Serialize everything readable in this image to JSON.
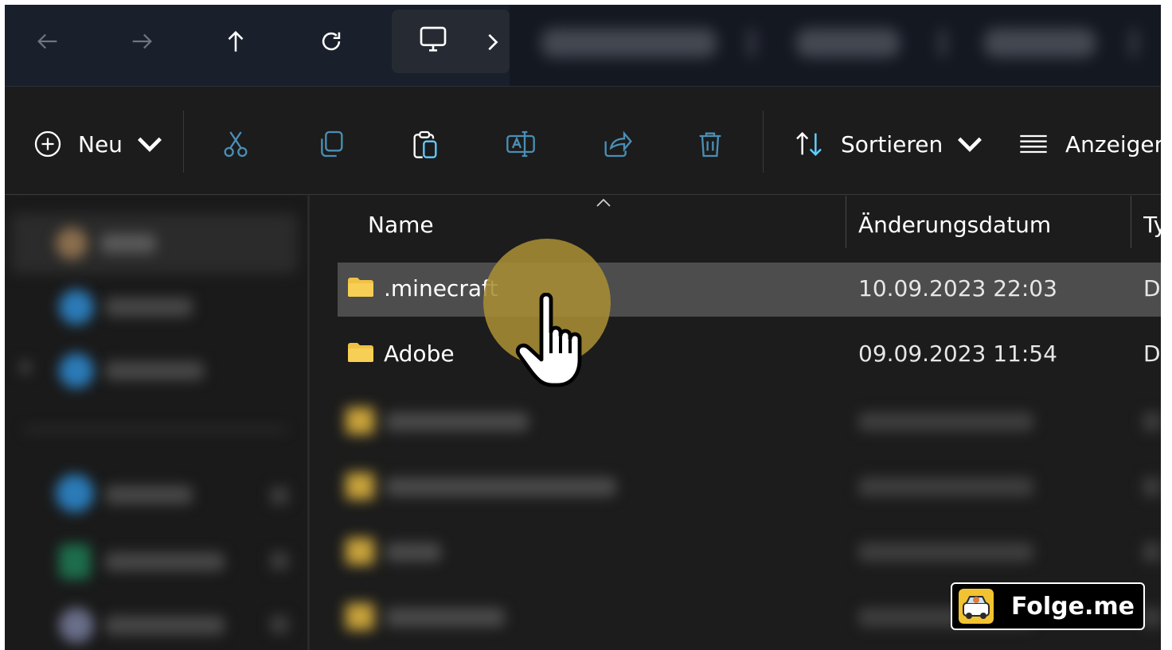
{
  "nav": {
    "buttons": [
      "back",
      "forward",
      "up",
      "refresh"
    ],
    "location_icon": "this-pc-icon"
  },
  "commandbar": {
    "new_label": "Neu",
    "sort_label": "Sortieren",
    "view_label": "Anzeigen",
    "icons": [
      "cut-icon",
      "copy-icon",
      "paste-icon",
      "rename-icon",
      "share-icon",
      "delete-icon"
    ]
  },
  "columns": {
    "name": "Name",
    "modified": "Änderungsdatum",
    "type": "Typ"
  },
  "files": [
    {
      "name": ".minecraft",
      "modified": "10.09.2023 22:03",
      "type": "D",
      "selected": true
    },
    {
      "name": "Adobe",
      "modified": "09.09.2023 11:54",
      "type": "D",
      "selected": false
    }
  ],
  "watermark": {
    "text": "Folge.me"
  },
  "colors": {
    "accent": "#60cdff",
    "folder": "#f0c244",
    "highlight": "#a88d34"
  }
}
